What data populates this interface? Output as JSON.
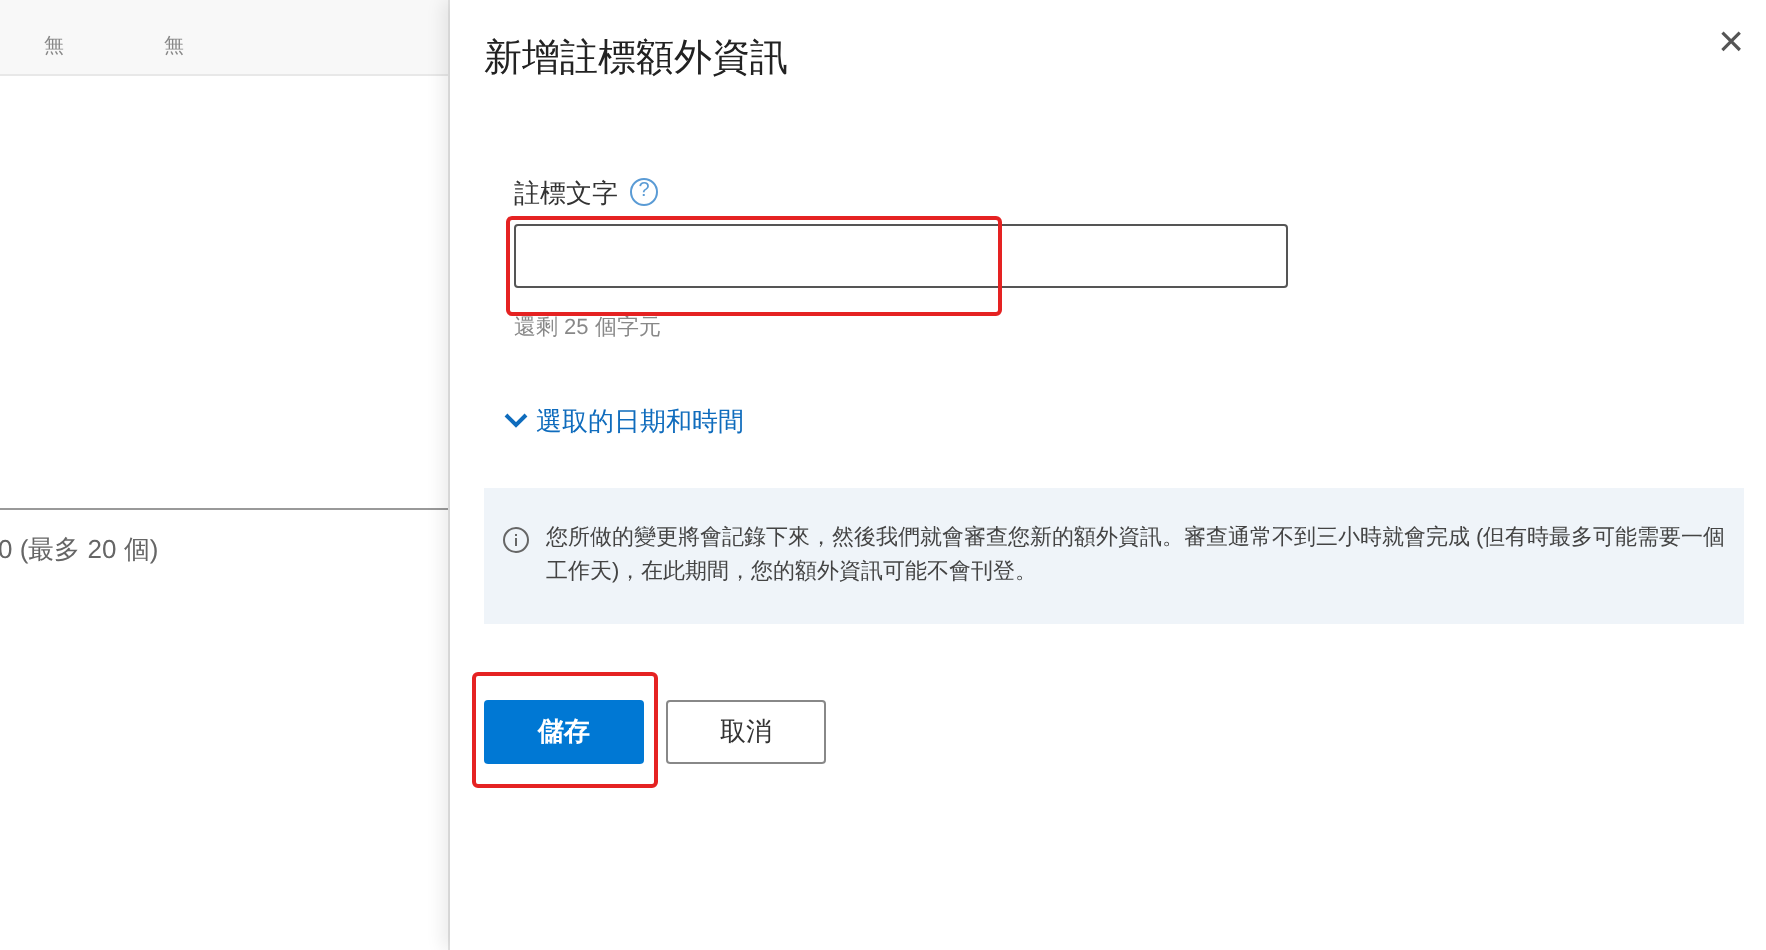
{
  "background_table": {
    "columns": [
      {
        "value": "無"
      },
      {
        "value": "無"
      }
    ],
    "footer": "0 (最多 20 個)"
  },
  "panel": {
    "title": "新增註標額外資訊",
    "close": "×",
    "field": {
      "label": "註標文字",
      "help": "?",
      "helper": "還剩 25 個字元",
      "highlighted": true
    },
    "expander": {
      "label": "選取的日期和時間",
      "expanded": false
    },
    "info": "您所做的變更將會記錄下來，然後我們就會審查您新的額外資訊。審查通常不到三小時就會完成 (但有時最多可能需要一個工作天)，在此期間，您的額外資訊可能不會刊登。",
    "buttons": [
      {
        "label": "儲存",
        "kind": "primary",
        "highlighted": true
      },
      {
        "label": "取消",
        "kind": "secondary",
        "highlighted": false
      }
    ]
  }
}
